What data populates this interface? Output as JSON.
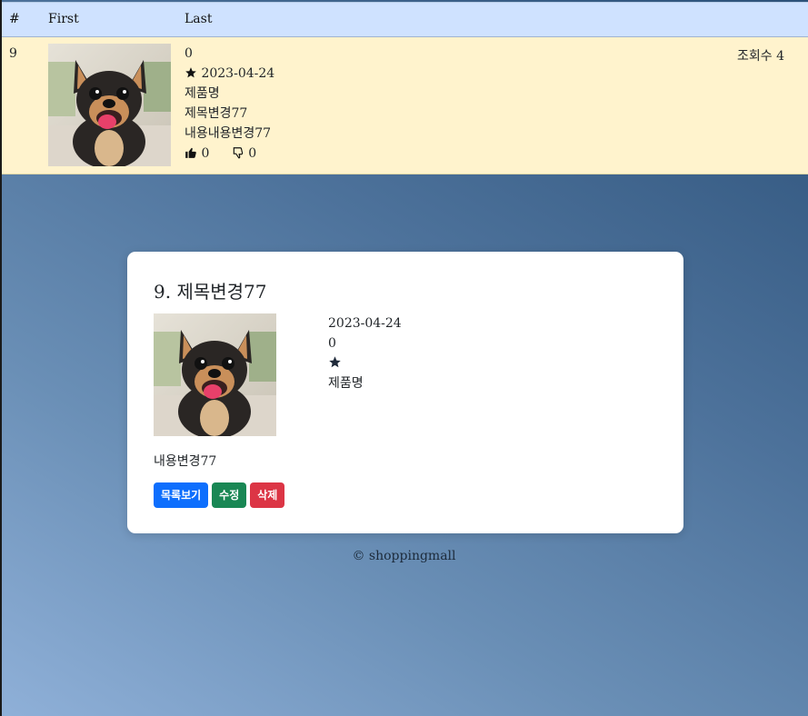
{
  "table": {
    "headers": [
      "#",
      "First",
      "Last"
    ],
    "row": {
      "num": "9",
      "price": "0",
      "date": "2023-04-24",
      "product": "제품명",
      "title": "제목변경77",
      "content": "내용내용변경77",
      "likes": "0",
      "dislikes": "0",
      "views": "조회수 4"
    }
  },
  "card": {
    "title": "9. 제목변경77",
    "date": "2023-04-24",
    "price": "0",
    "product": "제품명",
    "content": "내용변경77",
    "buttons": {
      "list": "목록보기",
      "edit": "수정",
      "delete": "삭제"
    }
  },
  "footer": "© shoppingmall",
  "colors": {
    "header_bg": "#cfe2ff",
    "row_bg": "#fff3cd",
    "primary": "#0d6efd",
    "success": "#198754",
    "danger": "#dc3545"
  },
  "icons": [
    "star-icon",
    "thumbs-up-icon",
    "thumbs-down-icon",
    "dog-photo"
  ]
}
